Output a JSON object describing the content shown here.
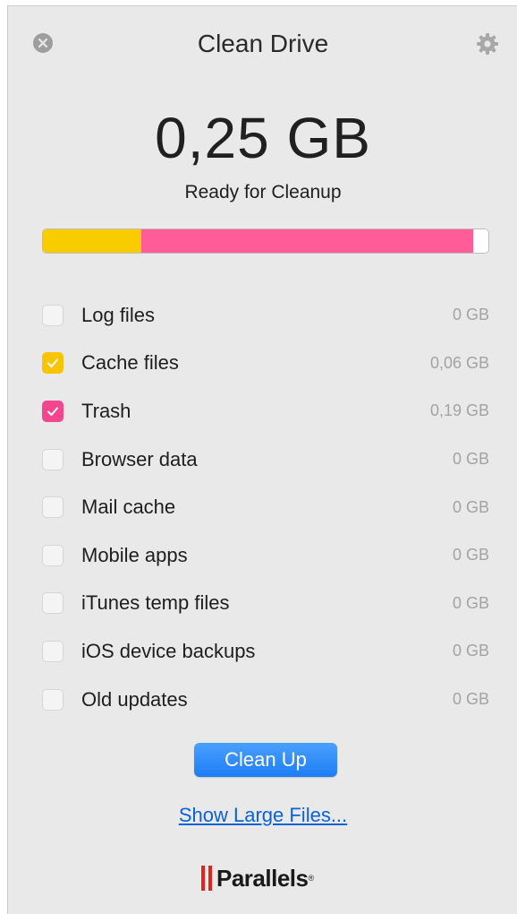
{
  "window": {
    "title": "Clean Drive"
  },
  "summary": {
    "total_size": "0,25 GB",
    "status": "Ready for Cleanup"
  },
  "usage_bar": {
    "cache_fraction": 0.22,
    "trash_fraction": 0.745,
    "cache_color": "#f8cc00",
    "trash_color": "#ff5c98"
  },
  "items": [
    {
      "label": "Log files",
      "size": "0 GB",
      "checked": false,
      "color": ""
    },
    {
      "label": "Cache files",
      "size": "0,06 GB",
      "checked": true,
      "color": "#f8c400"
    },
    {
      "label": "Trash",
      "size": "0,19 GB",
      "checked": true,
      "color": "#f2468e"
    },
    {
      "label": "Browser data",
      "size": "0 GB",
      "checked": false,
      "color": ""
    },
    {
      "label": "Mail cache",
      "size": "0 GB",
      "checked": false,
      "color": ""
    },
    {
      "label": "Mobile apps",
      "size": "0 GB",
      "checked": false,
      "color": ""
    },
    {
      "label": "iTunes temp files",
      "size": "0 GB",
      "checked": false,
      "color": ""
    },
    {
      "label": "iOS device backups",
      "size": "0 GB",
      "checked": false,
      "color": ""
    },
    {
      "label": "Old updates",
      "size": "0 GB",
      "checked": false,
      "color": ""
    }
  ],
  "actions": {
    "clean_up_label": "Clean Up",
    "show_large_files_label": "Show Large Files..."
  },
  "brand": {
    "name": "Parallels",
    "reg": "®"
  },
  "icons": {
    "close": "close-icon",
    "settings": "gear-icon",
    "check": "checkmark-icon",
    "logo": "parallels-logo"
  }
}
